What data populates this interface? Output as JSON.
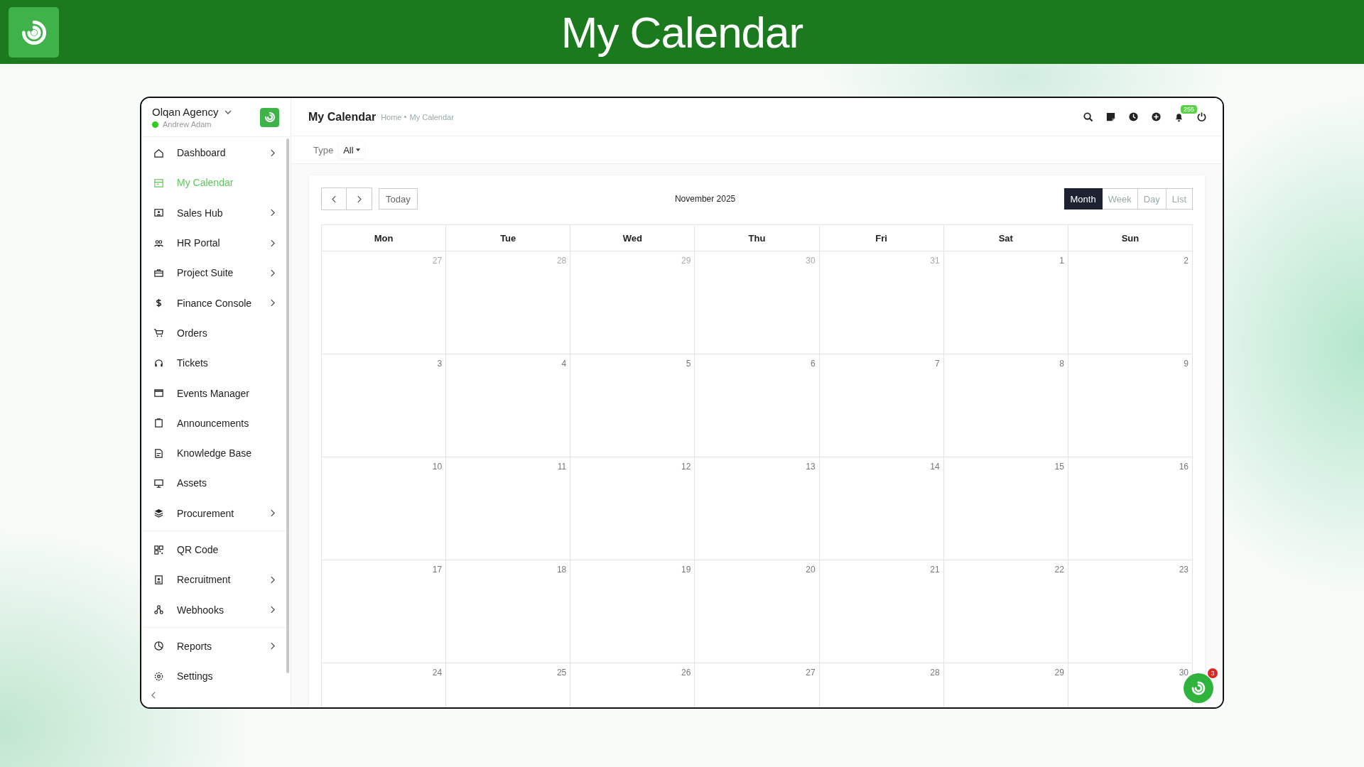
{
  "banner": {
    "title": "My Calendar"
  },
  "sidebar": {
    "org": "Olqan Agency",
    "user": "Andrew Adam",
    "online": true,
    "sections": [
      [
        {
          "label": "Dashboard",
          "selected": false,
          "expandable": true
        },
        {
          "label": "My Calendar",
          "selected": true,
          "expandable": false
        },
        {
          "label": "Sales Hub",
          "selected": false,
          "expandable": true
        },
        {
          "label": "HR Portal",
          "selected": false,
          "expandable": true
        },
        {
          "label": "Project Suite",
          "selected": false,
          "expandable": true
        },
        {
          "label": "Finance Console",
          "selected": false,
          "expandable": true
        },
        {
          "label": "Orders",
          "selected": false,
          "expandable": false
        },
        {
          "label": "Tickets",
          "selected": false,
          "expandable": false
        },
        {
          "label": "Events Manager",
          "selected": false,
          "expandable": false
        },
        {
          "label": "Announcements",
          "selected": false,
          "expandable": false
        },
        {
          "label": "Knowledge Base",
          "selected": false,
          "expandable": false
        },
        {
          "label": "Assets",
          "selected": false,
          "expandable": false
        },
        {
          "label": "Procurement",
          "selected": false,
          "expandable": true
        }
      ],
      [
        {
          "label": "QR Code",
          "selected": false,
          "expandable": false
        },
        {
          "label": "Recruitment",
          "selected": false,
          "expandable": true
        },
        {
          "label": "Webhooks",
          "selected": false,
          "expandable": true
        }
      ],
      [
        {
          "label": "Reports",
          "selected": false,
          "expandable": true
        },
        {
          "label": "Settings",
          "selected": false,
          "expandable": false
        }
      ]
    ]
  },
  "topbar": {
    "title": "My Calendar",
    "breadcrumb": [
      "Home",
      "My Calendar"
    ],
    "notification_count": "255"
  },
  "filter": {
    "label": "Type",
    "value": "All"
  },
  "calendar": {
    "today_button": "Today",
    "period": "November 2025",
    "views": [
      {
        "label": "Month",
        "selected": true
      },
      {
        "label": "Week",
        "selected": false
      },
      {
        "label": "Day",
        "selected": false
      },
      {
        "label": "List",
        "selected": false
      }
    ],
    "weekdays": [
      "Mon",
      "Tue",
      "Wed",
      "Thu",
      "Fri",
      "Sat",
      "Sun"
    ],
    "weeks": [
      [
        {
          "day": "27",
          "other_month": true
        },
        {
          "day": "28",
          "other_month": true
        },
        {
          "day": "29",
          "other_month": true
        },
        {
          "day": "30",
          "other_month": true
        },
        {
          "day": "31",
          "other_month": true
        },
        {
          "day": "1",
          "other_month": false
        },
        {
          "day": "2",
          "other_month": false
        }
      ],
      [
        {
          "day": "3",
          "other_month": false
        },
        {
          "day": "4",
          "other_month": false
        },
        {
          "day": "5",
          "other_month": false
        },
        {
          "day": "6",
          "other_month": false
        },
        {
          "day": "7",
          "other_month": false
        },
        {
          "day": "8",
          "other_month": false
        },
        {
          "day": "9",
          "other_month": false
        }
      ],
      [
        {
          "day": "10",
          "other_month": false
        },
        {
          "day": "11",
          "other_month": false
        },
        {
          "day": "12",
          "other_month": false
        },
        {
          "day": "13",
          "other_month": false
        },
        {
          "day": "14",
          "other_month": false
        },
        {
          "day": "15",
          "other_month": false
        },
        {
          "day": "16",
          "other_month": false
        }
      ],
      [
        {
          "day": "17",
          "other_month": false
        },
        {
          "day": "18",
          "other_month": false
        },
        {
          "day": "19",
          "other_month": false
        },
        {
          "day": "20",
          "other_month": false
        },
        {
          "day": "21",
          "other_month": false
        },
        {
          "day": "22",
          "other_month": false
        },
        {
          "day": "23",
          "other_month": false
        }
      ],
      [
        {
          "day": "24",
          "other_month": false
        },
        {
          "day": "25",
          "other_month": false
        },
        {
          "day": "26",
          "other_month": false
        },
        {
          "day": "27",
          "other_month": false
        },
        {
          "day": "28",
          "other_month": false
        },
        {
          "day": "29",
          "other_month": false
        },
        {
          "day": "30",
          "other_month": false
        }
      ]
    ]
  },
  "chat_button": {
    "badge": "3"
  }
}
